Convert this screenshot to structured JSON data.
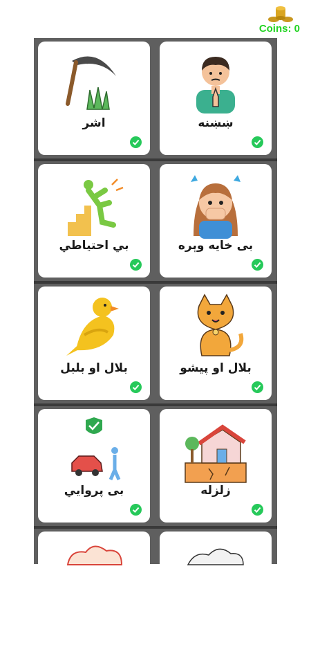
{
  "header": {
    "coins_text": "Coins: 0"
  },
  "cards": [
    {
      "label": "ښښنه",
      "icon": "praying-boy-icon",
      "completed": true
    },
    {
      "label": "اشر",
      "icon": "scythe-grass-icon",
      "completed": true
    },
    {
      "label": "بی خایه وېره",
      "icon": "scared-girl-icon",
      "completed": true
    },
    {
      "label": "بي احتياطي",
      "icon": "falling-stairs-icon",
      "completed": true
    },
    {
      "label": "بلال او پيشو",
      "icon": "cat-icon",
      "completed": true
    },
    {
      "label": "بلال او بلبل",
      "icon": "bird-icon",
      "completed": true
    },
    {
      "label": "زلزله",
      "icon": "earthquake-house-icon",
      "completed": true
    },
    {
      "label": "بی پروایي",
      "icon": "car-accident-icon",
      "completed": true
    }
  ],
  "colors": {
    "check": "#26c95a",
    "coins_text": "#22d422",
    "board": "#5f5f5f"
  }
}
